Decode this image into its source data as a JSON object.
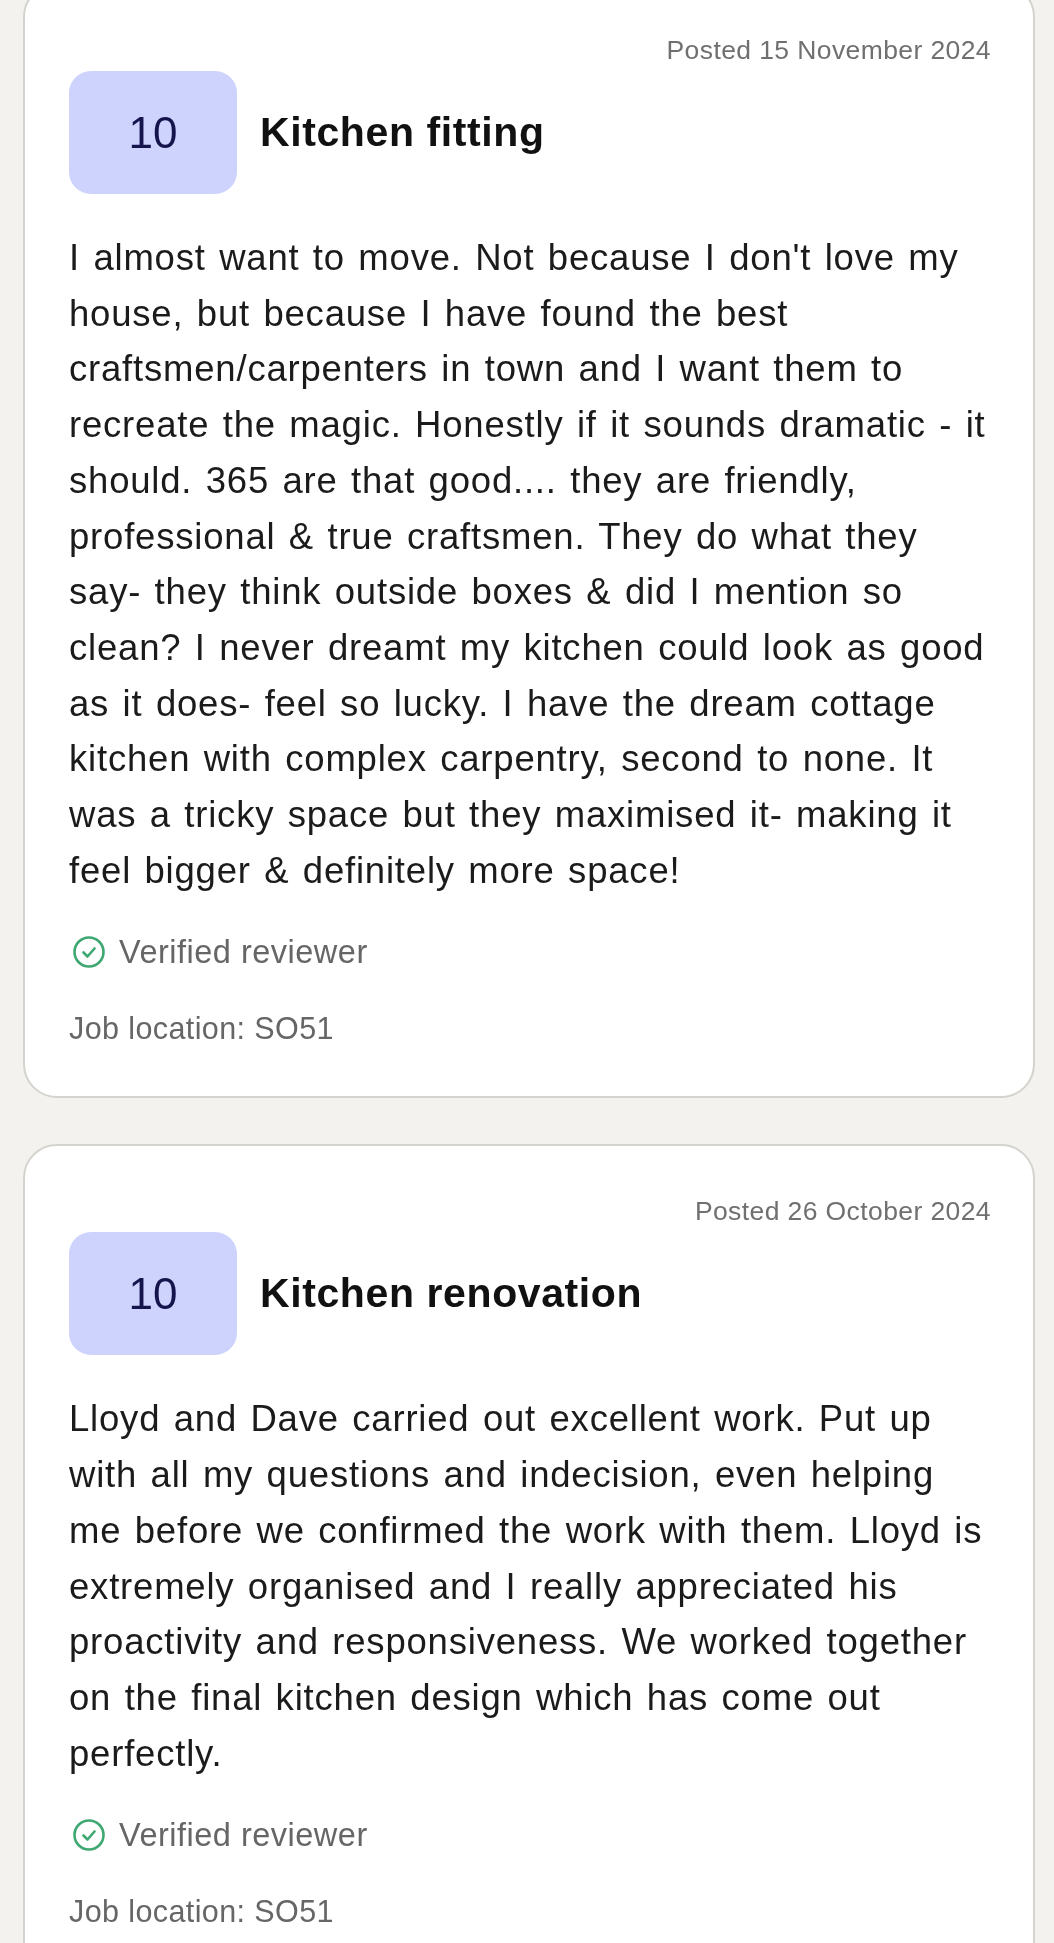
{
  "reviews": [
    {
      "posted": "Posted 15 November 2024",
      "score": "10",
      "title": "Kitchen fitting",
      "body": "I almost want to move. Not because I don't love my house, but because I have found the best craftsmen/carpenters in town and I want them to recreate the magic. Honestly if it sounds dramatic - it should. 365 are that good.... they are friendly, professional & true craftsmen. They do what they say- they think outside boxes & did I mention so clean? I never dreamt my kitchen could look as good as it does- feel so lucky. I have the dream cottage kitchen with complex carpentry, second to none. It was a tricky space but they maximised it- making it feel bigger & definitely more space!",
      "verified_badge": "Verified reviewer",
      "job_location": "Job location: SO51"
    },
    {
      "posted": "Posted 26 October 2024",
      "score": "10",
      "title": "Kitchen renovation",
      "body": "Lloyd and Dave carried out excellent work. Put up with all my questions and indecision, even helping me before we confirmed the work with them. Lloyd is extremely organised and I really appreciated his proactivity and responsiveness. We worked together on the final kitchen design which has come out perfectly.",
      "verified_badge": "Verified reviewer",
      "job_location": "Job location: SO51"
    }
  ]
}
